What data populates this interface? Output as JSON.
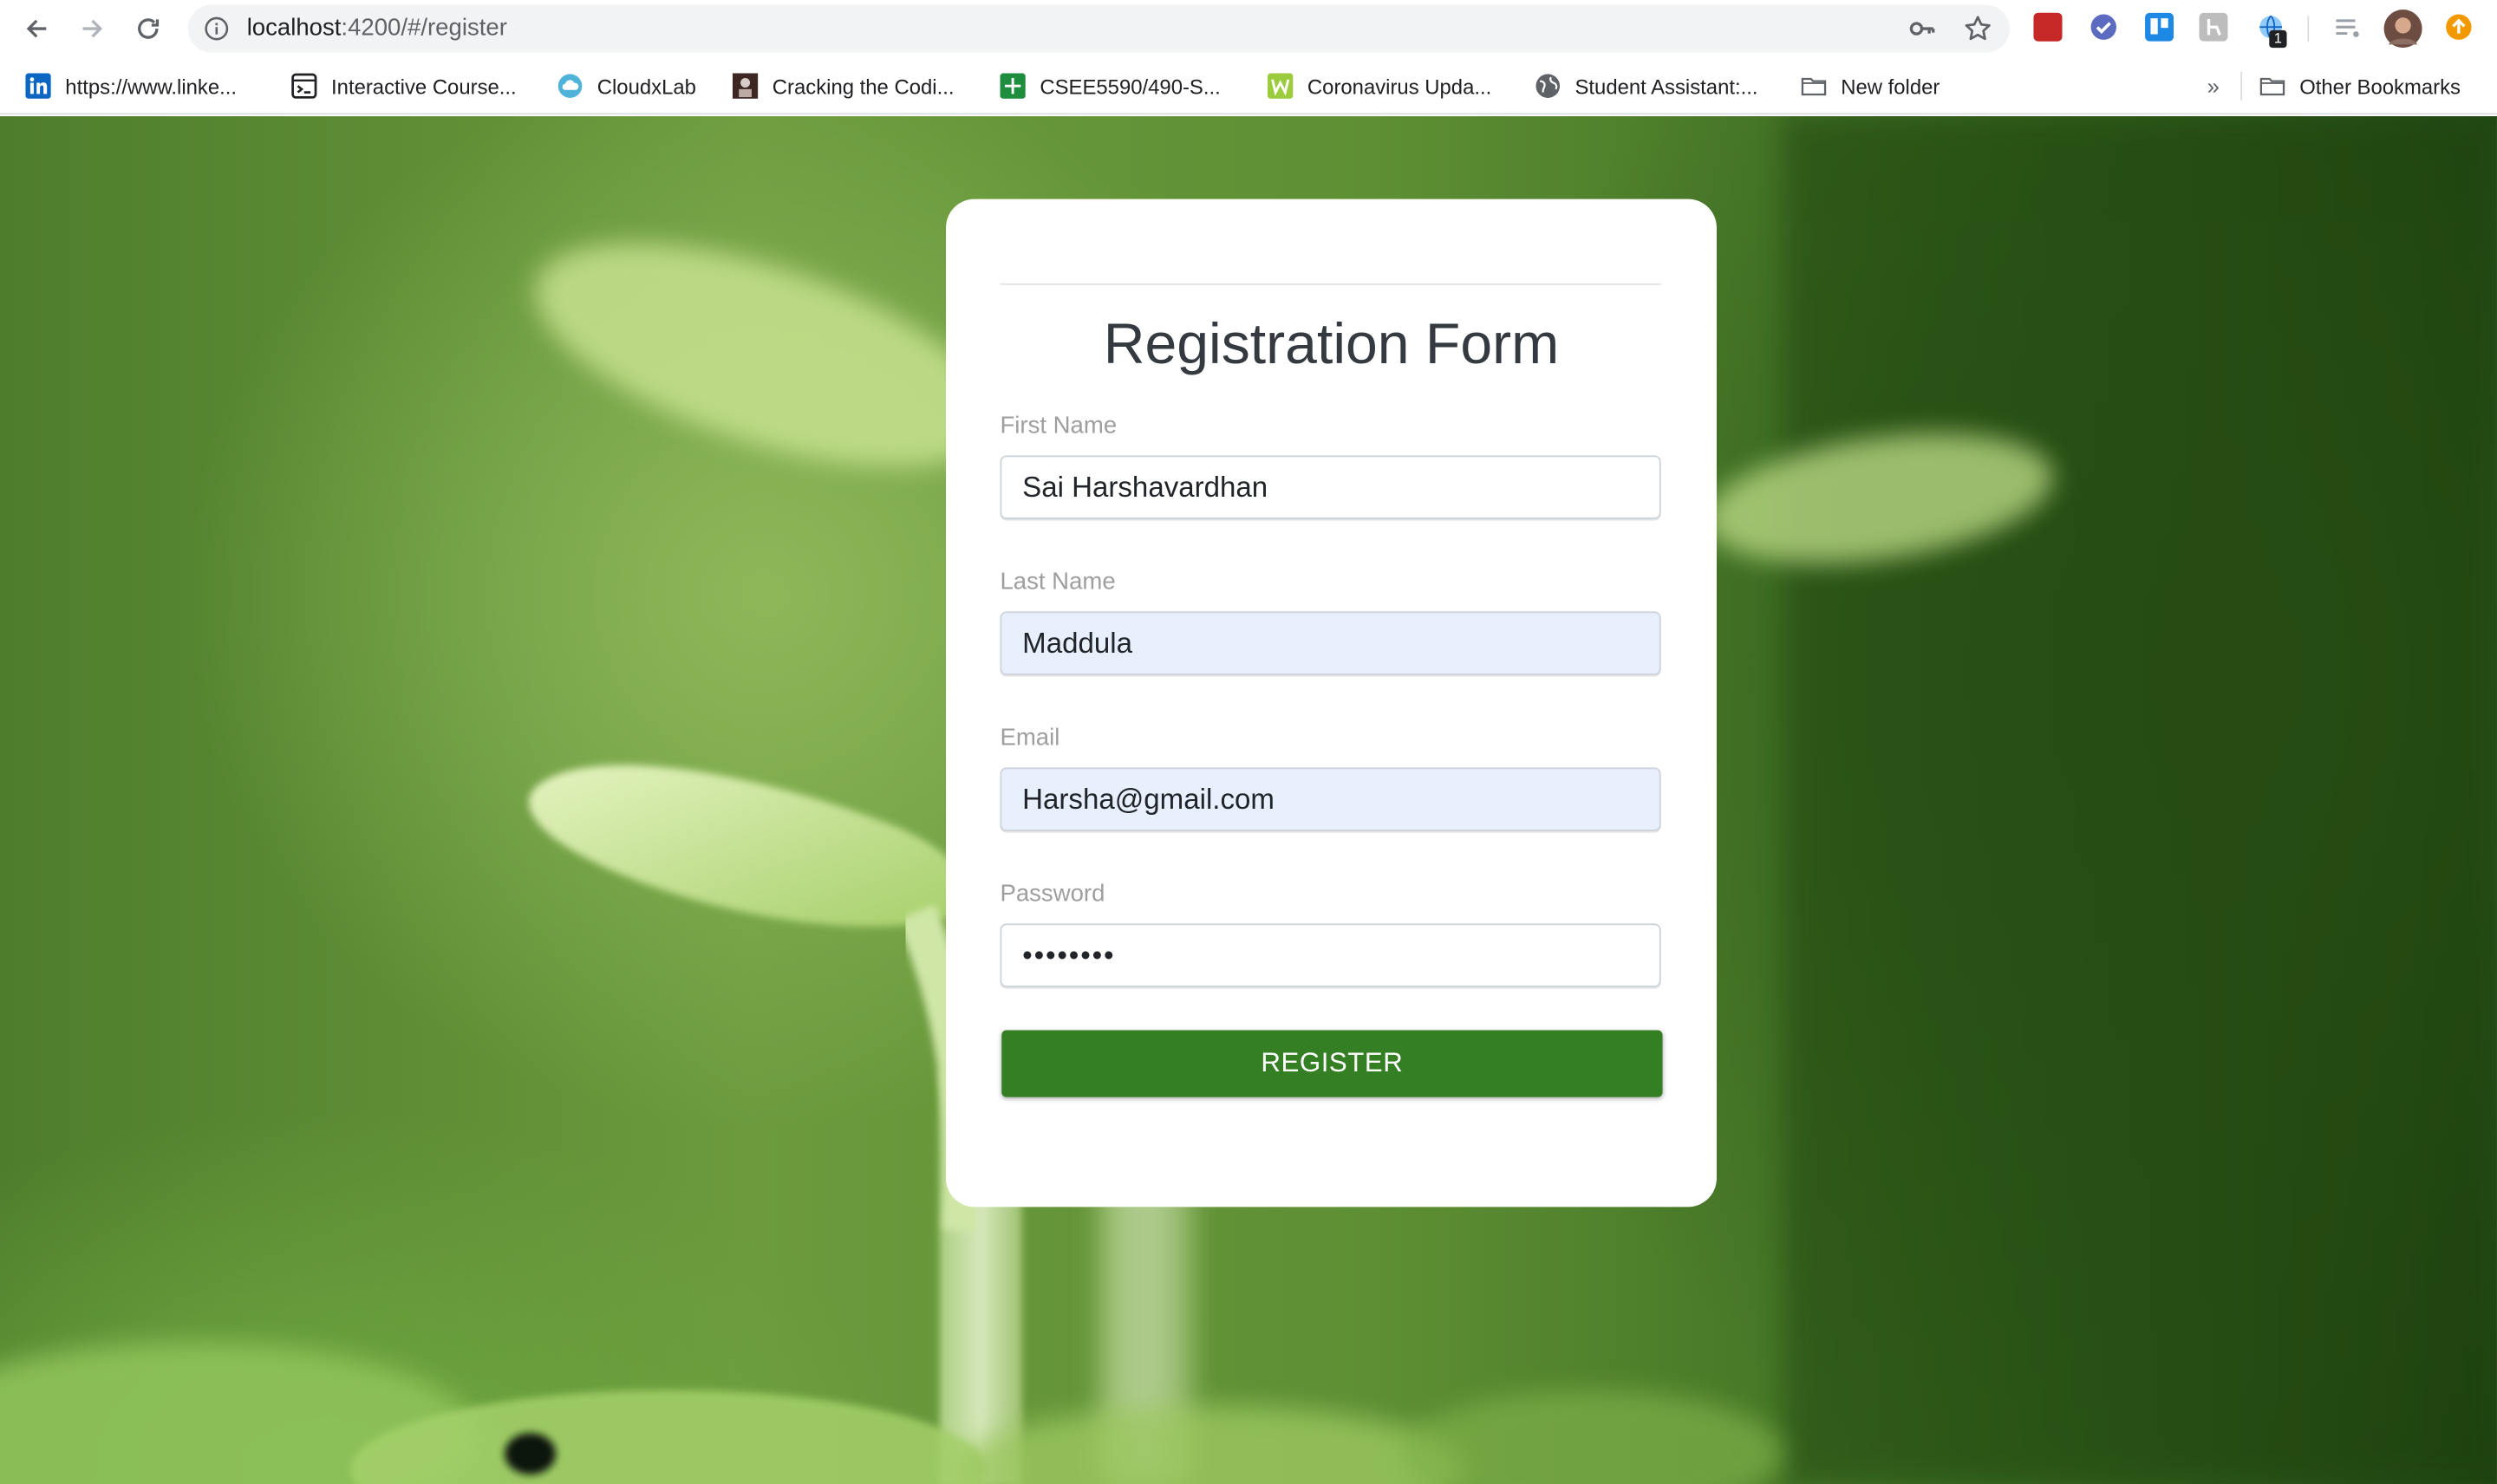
{
  "browser": {
    "url_host": "localhost",
    "url_rest": ":4200/#/register",
    "extension_badge": "1",
    "bookmarks": [
      {
        "label": "https://www.linke...",
        "icon": "linkedin-icon"
      },
      {
        "label": "Interactive Course...",
        "icon": "terminal-icon"
      },
      {
        "label": "CloudxLab",
        "icon": "cloud-icon"
      },
      {
        "label": "Cracking the Codi...",
        "icon": "book-cover-icon"
      },
      {
        "label": "CSEE5590/490-S...",
        "icon": "sheets-icon"
      },
      {
        "label": "Coronavirus Upda...",
        "icon": "w-logo-icon"
      },
      {
        "label": "Student Assistant:...",
        "icon": "globe-icon"
      },
      {
        "label": "New folder",
        "icon": "folder-icon"
      }
    ],
    "overflow_label": "»",
    "other_bookmarks": "Other Bookmarks"
  },
  "form": {
    "title": "Registration Form",
    "first_name_label": "First Name",
    "first_name_value": "Sai Harshavardhan",
    "last_name_label": "Last Name",
    "last_name_value": "Maddula",
    "email_label": "Email",
    "email_value": "Harsha@gmail.com",
    "password_label": "Password",
    "password_value": "••••••••",
    "register_label": "REGISTER"
  },
  "colors": {
    "register_button": "#347f24",
    "autofill_background": "#e8f0fe"
  }
}
